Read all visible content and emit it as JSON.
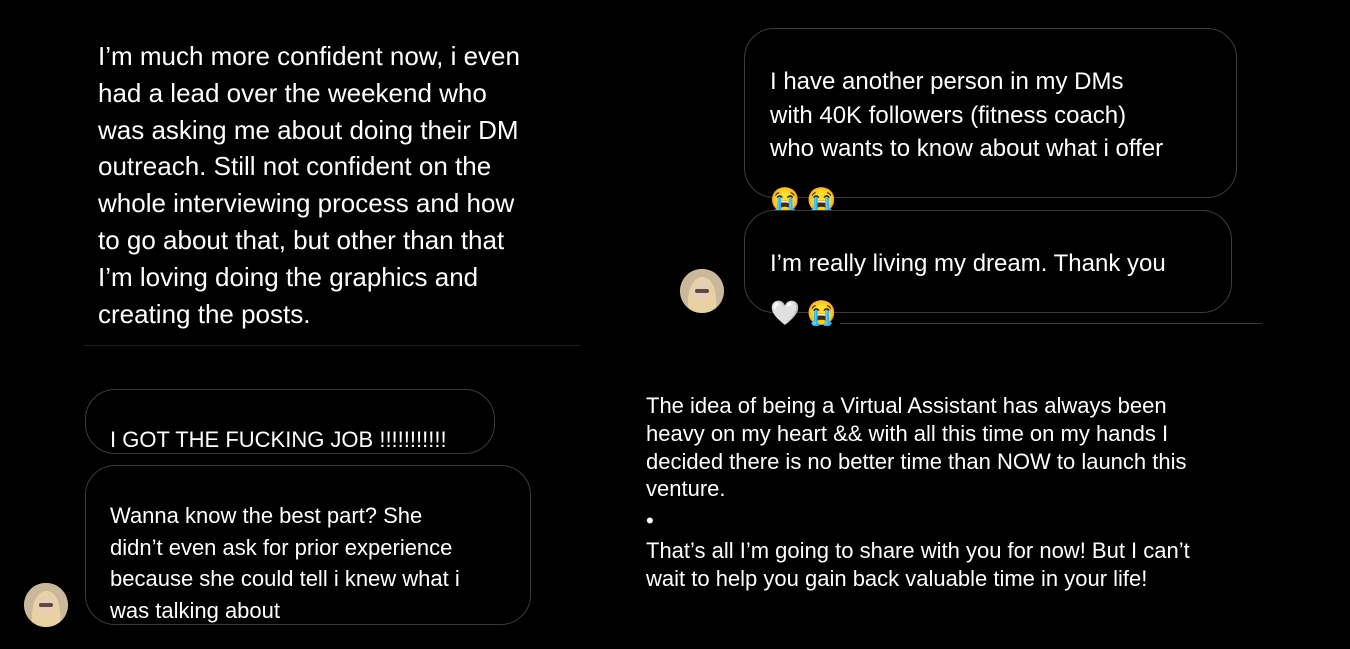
{
  "panel1": {
    "message": "I’m much more confident now, i even\nhad a lead over the weekend who\nwas asking me about doing their DM\noutreach. Still not confident on the\nwhole interviewing process and how\nto go about that, but other than that\nI’m loving doing the graphics and\ncreating the posts."
  },
  "panel2": {
    "bubble1_text": "I have another person in my DMs\nwith 40K followers (fitness coach)\nwho wants to know about what i offer",
    "bubble1_emoji": "😭 😭",
    "bubble2_text": "I’m really living my dream. Thank you",
    "bubble2_emoji": "🤍 😭"
  },
  "panel3": {
    "bubble1": "I GOT THE FUCKING JOB !!!!!!!!!!!",
    "bubble2": "Wanna know the best part? She\ndidn’t even ask for prior experience\nbecause she could tell i knew what i\nwas talking about"
  },
  "panel4": {
    "paragraph1": "The idea of being a Virtual Assistant has always been\nheavy on my heart && with all this time on my hands I\ndecided there is no better time than NOW to launch this\nventure.",
    "bullet": "•",
    "paragraph2": "That’s all I’m going to share with you for now! But I can’t\nwait to help you gain back valuable time in your life!"
  }
}
